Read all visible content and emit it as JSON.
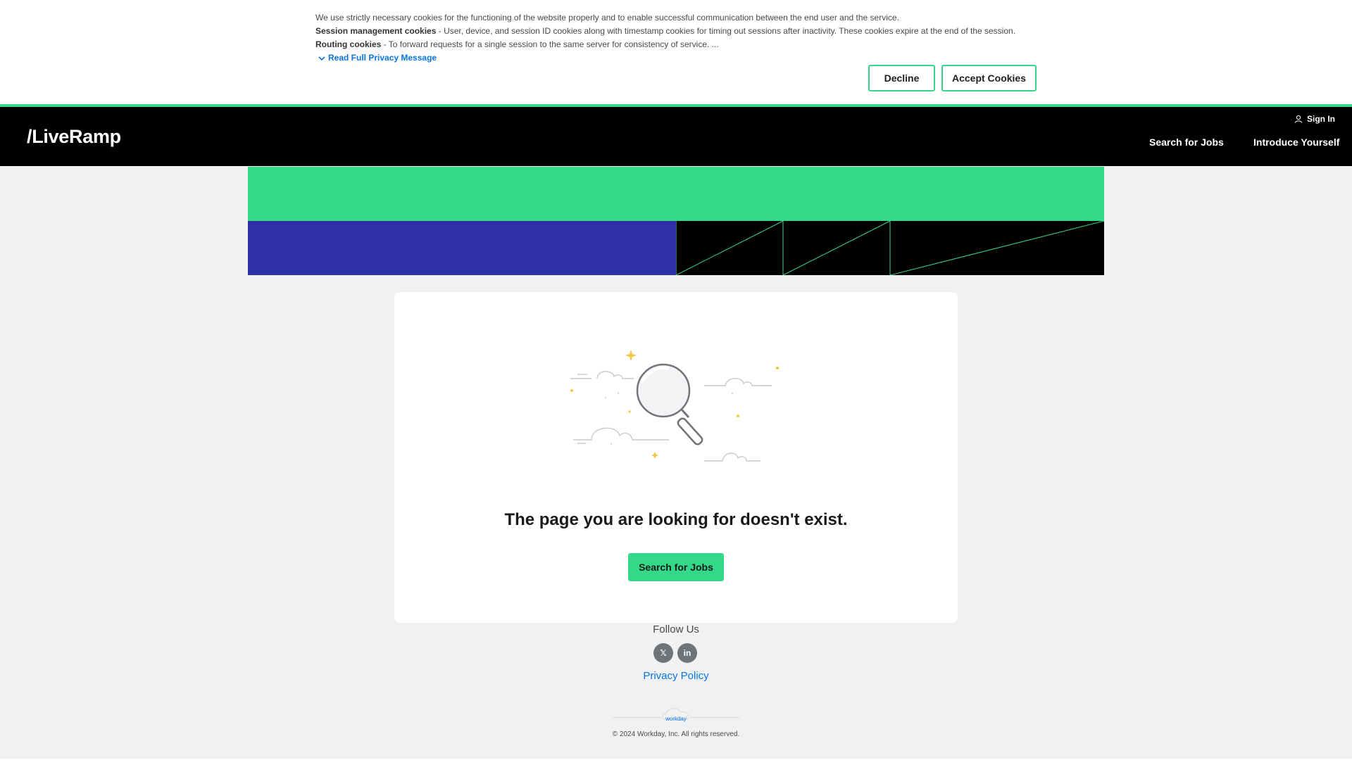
{
  "cookie": {
    "intro": "We use strictly necessary cookies for the functioning of the website properly and to enable successful communication between the end user and the service.",
    "session_title": "Session management cookies",
    "session_text": " - User, device, and session ID cookies along with timestamp cookies for timing out sessions after inactivity. These cookies expire at the end of the session.",
    "routing_title": "Routing cookies",
    "routing_text": " - To forward requests for a single session to the same server for consistency of service. ...",
    "read_more": "Read Full Privacy Message",
    "decline": "Decline",
    "accept": "Accept Cookies",
    "accent": "#34d889"
  },
  "header": {
    "logo": "/LiveRamp",
    "sign_in": "Sign In",
    "nav": [
      "Search for Jobs",
      "Introduce Yourself"
    ]
  },
  "banner": {
    "colors": {
      "green": "#34d889",
      "blue": "#2e30aa",
      "black": "#000000"
    }
  },
  "main": {
    "message": "The page you are looking for doesn't exist.",
    "button": "Search for Jobs",
    "illustration": "magnifying-glass-icon"
  },
  "footer": {
    "follow": "Follow Us",
    "social": [
      {
        "icon": "x-twitter-icon",
        "glyph": "𝕏"
      },
      {
        "icon": "linkedin-icon",
        "glyph": "in"
      }
    ],
    "privacy": "Privacy Policy",
    "powered_by": "workday",
    "copyright": "© 2024 Workday, Inc. All rights reserved."
  }
}
